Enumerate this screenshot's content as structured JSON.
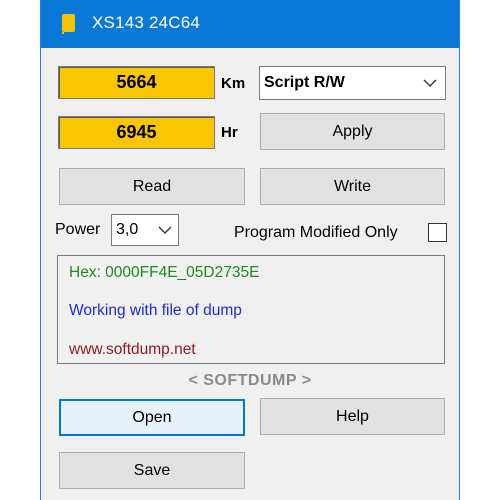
{
  "window": {
    "title": "XS143 24C64"
  },
  "fields": {
    "km_value": "5664",
    "km_unit": "Km",
    "hr_value": "6945",
    "hr_unit": "Hr"
  },
  "mode_select": {
    "selected": "Script R/W"
  },
  "buttons": {
    "apply": "Apply",
    "read": "Read",
    "write": "Write",
    "open": "Open",
    "help": "Help",
    "save": "Save"
  },
  "power": {
    "label": "Power",
    "selected": "3,0"
  },
  "program_modified_only": {
    "label": "Program Modified Only",
    "checked": false
  },
  "info": {
    "hex": "Hex: 0000FF4E_05D2735E",
    "status": "Working with file of dump",
    "website": "www.softdump.net"
  },
  "brand": "< SOFTDUMP >",
  "colors": {
    "titlebar": "#0a78d7",
    "field_yellow": "#f8c603",
    "hex_green": "#1e8a1e",
    "status_blue": "#1c2ccf",
    "website_red": "#8b1c1c",
    "brand_gray": "#8a8a8a"
  }
}
